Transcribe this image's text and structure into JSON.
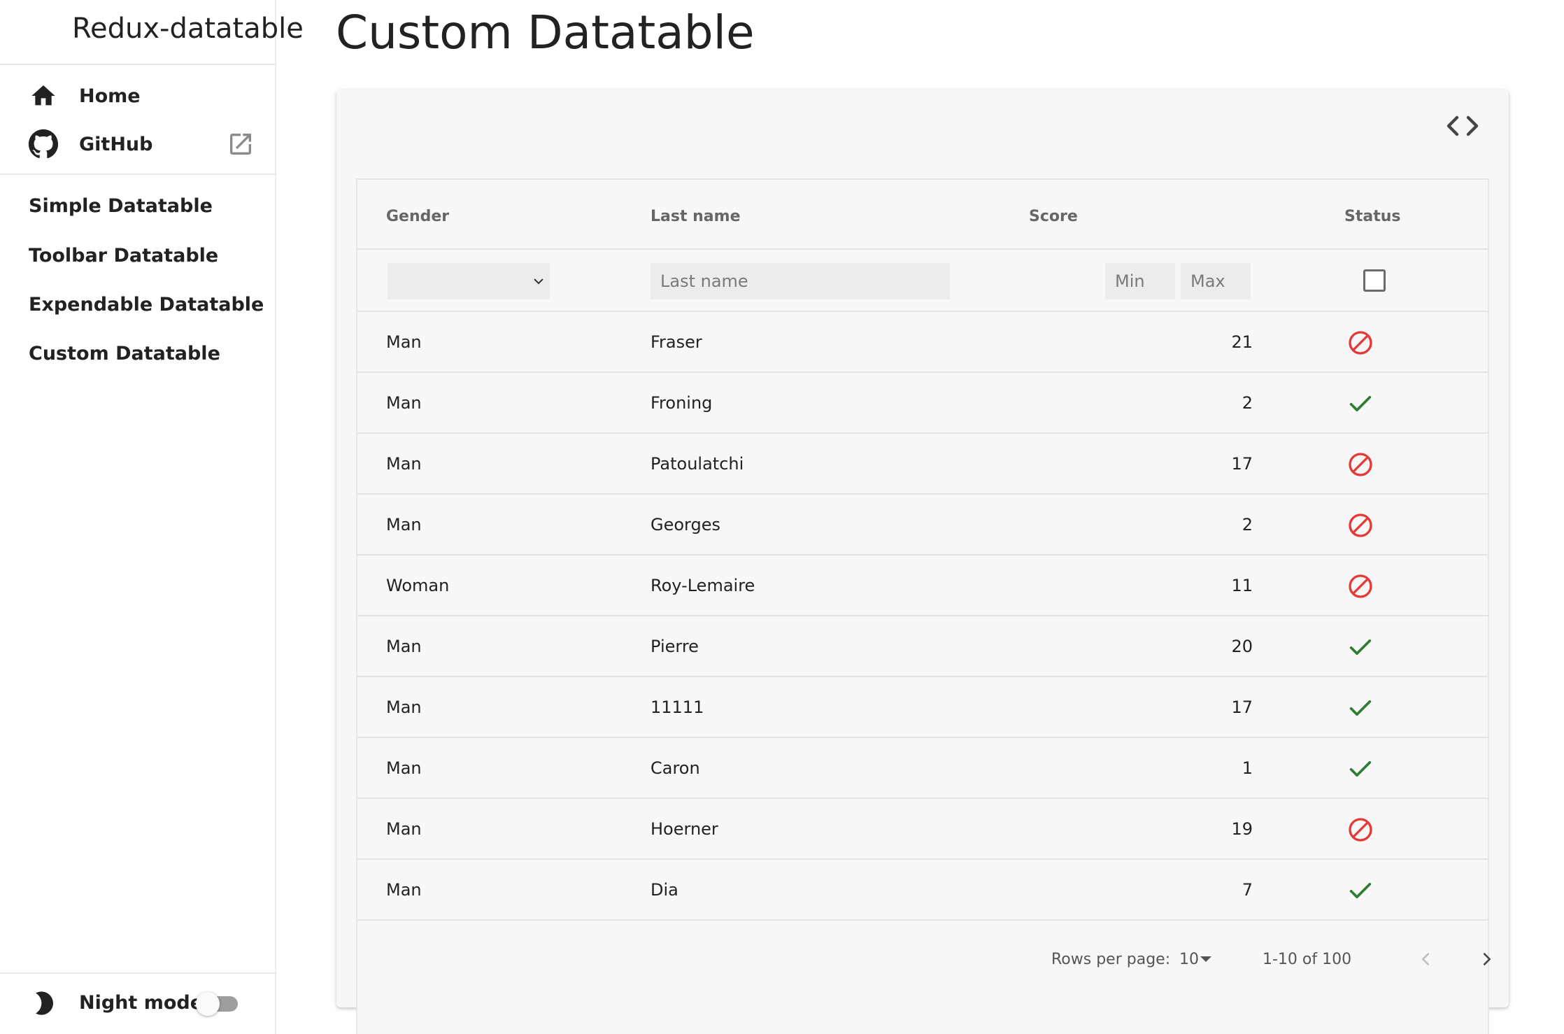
{
  "app": {
    "title": "Redux-datatable"
  },
  "sidebar": {
    "top_items": [
      {
        "label": "Home",
        "icon": "home-icon"
      },
      {
        "label": "GitHub",
        "icon": "github-icon",
        "trailing_icon": "open-in-new-icon"
      }
    ],
    "links": [
      {
        "label": "Simple Datatable"
      },
      {
        "label": "Toolbar Datatable"
      },
      {
        "label": "Expendable Datatable"
      },
      {
        "label": "Custom Datatable"
      }
    ],
    "night_mode": {
      "label": "Night mode",
      "icon": "moon-icon",
      "enabled": false
    }
  },
  "main": {
    "title": "Custom Datatable",
    "code_toggle_icon": "code-icon"
  },
  "table": {
    "columns": [
      "Gender",
      "Last name",
      "Score",
      "Status"
    ],
    "filters": {
      "gender_value": "",
      "last_name_placeholder": "Last name",
      "score_min_placeholder": "Min",
      "score_max_placeholder": "Max",
      "status_checked": false
    },
    "rows": [
      {
        "gender": "Man",
        "last_name": "Fraser",
        "score": "21",
        "status": "blocked"
      },
      {
        "gender": "Man",
        "last_name": "Froning",
        "score": "2",
        "status": "active"
      },
      {
        "gender": "Man",
        "last_name": "Patoulatchi",
        "score": "17",
        "status": "blocked"
      },
      {
        "gender": "Man",
        "last_name": "Georges",
        "score": "2",
        "status": "blocked"
      },
      {
        "gender": "Woman",
        "last_name": "Roy-Lemaire",
        "score": "11",
        "status": "blocked"
      },
      {
        "gender": "Man",
        "last_name": "Pierre",
        "score": "20",
        "status": "active"
      },
      {
        "gender": "Man",
        "last_name": "11111",
        "score": "17",
        "status": "active"
      },
      {
        "gender": "Man",
        "last_name": "Caron",
        "score": "1",
        "status": "active"
      },
      {
        "gender": "Man",
        "last_name": "Hoerner",
        "score": "19",
        "status": "blocked"
      },
      {
        "gender": "Man",
        "last_name": "Dia",
        "score": "7",
        "status": "active"
      }
    ],
    "pagination": {
      "rows_per_page_label": "Rows per page:",
      "rows_per_page_value": "10",
      "range_label": "1-10 of 100"
    }
  },
  "colors": {
    "status_blocked": "#e53935",
    "status_active": "#2e7d32",
    "text": "#222222",
    "muted": "#666666"
  }
}
